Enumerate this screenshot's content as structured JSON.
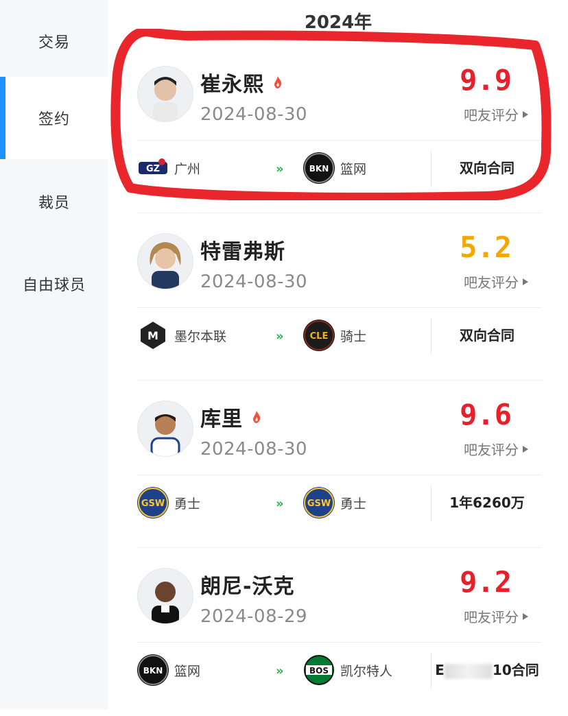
{
  "sidebar": {
    "items": [
      {
        "label": "交易"
      },
      {
        "label": "签约"
      },
      {
        "label": "裁员"
      },
      {
        "label": "自由球员"
      }
    ]
  },
  "header": {
    "year": "2024年"
  },
  "score_label": "吧友评分",
  "players": [
    {
      "name": "崔永熙",
      "hot": true,
      "date": "2024-08-30",
      "score": "9.9",
      "score_color": "#e8202b",
      "from_team": "广州",
      "to_team": "篮网",
      "contract": "双向合同"
    },
    {
      "name": "特雷弗斯",
      "hot": false,
      "date": "2024-08-30",
      "score": "5.2",
      "score_color": "#f5a600",
      "from_team": "墨尔本联",
      "to_team": "骑士",
      "contract": "双向合同"
    },
    {
      "name": "库里",
      "hot": true,
      "date": "2024-08-30",
      "score": "9.6",
      "score_color": "#e8202b",
      "from_team": "勇士",
      "to_team": "勇士",
      "contract": "1年6260万"
    },
    {
      "name": "朗尼-沃克",
      "hot": false,
      "date": "2024-08-29",
      "score": "9.2",
      "score_color": "#e8202b",
      "from_team": "篮网",
      "to_team": "凯尔特人",
      "contract_prefix": "E",
      "contract": "10合同"
    }
  ],
  "colors": {
    "accent": "#1e90ff",
    "arrow": "#2bb04a",
    "annotation": "#e8262b"
  }
}
